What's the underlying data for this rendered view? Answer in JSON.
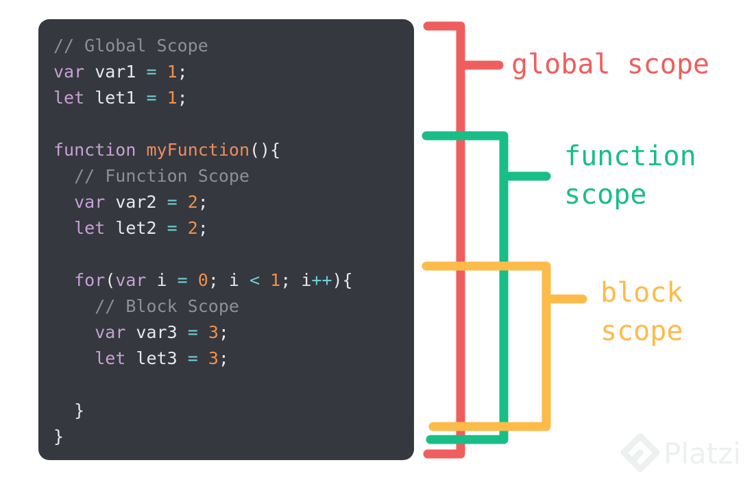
{
  "colors": {
    "panel_background": "#35383e",
    "comment": "#8d9097",
    "keyword": "#c7a0d6",
    "function_name": "#ef8c5f",
    "number": "#f0914c",
    "operator": "#6fd0d9",
    "identifier": "#e8e8ea",
    "global_scope": "#ef5e5e",
    "function_scope": "#18be86",
    "block_scope": "#fdbb4a"
  },
  "code": {
    "lines": [
      [
        {
          "t": "// Global Scope",
          "k": "comment"
        }
      ],
      [
        {
          "t": "var",
          "k": "keyword"
        },
        {
          "t": " var1 ",
          "k": "ident"
        },
        {
          "t": "=",
          "k": "op"
        },
        {
          "t": " ",
          "k": "ident"
        },
        {
          "t": "1",
          "k": "number"
        },
        {
          "t": ";",
          "k": "punct"
        }
      ],
      [
        {
          "t": "let",
          "k": "keyword"
        },
        {
          "t": " let1 ",
          "k": "ident"
        },
        {
          "t": "=",
          "k": "op"
        },
        {
          "t": " ",
          "k": "ident"
        },
        {
          "t": "1",
          "k": "number"
        },
        {
          "t": ";",
          "k": "punct"
        }
      ],
      [],
      [
        {
          "t": "function",
          "k": "keyword"
        },
        {
          "t": " ",
          "k": "ident"
        },
        {
          "t": "myFunction",
          "k": "func"
        },
        {
          "t": "(){",
          "k": "punct"
        }
      ],
      [
        {
          "t": "  // Function Scope",
          "k": "comment"
        }
      ],
      [
        {
          "t": "  ",
          "k": "ident"
        },
        {
          "t": "var",
          "k": "keyword"
        },
        {
          "t": " var2 ",
          "k": "ident"
        },
        {
          "t": "=",
          "k": "op"
        },
        {
          "t": " ",
          "k": "ident"
        },
        {
          "t": "2",
          "k": "number"
        },
        {
          "t": ";",
          "k": "punct"
        }
      ],
      [
        {
          "t": "  ",
          "k": "ident"
        },
        {
          "t": "let",
          "k": "keyword"
        },
        {
          "t": " let2 ",
          "k": "ident"
        },
        {
          "t": "=",
          "k": "op"
        },
        {
          "t": " ",
          "k": "ident"
        },
        {
          "t": "2",
          "k": "number"
        },
        {
          "t": ";",
          "k": "punct"
        }
      ],
      [],
      [
        {
          "t": "  ",
          "k": "ident"
        },
        {
          "t": "for",
          "k": "keyword"
        },
        {
          "t": "(",
          "k": "punct"
        },
        {
          "t": "var",
          "k": "keyword"
        },
        {
          "t": " i ",
          "k": "ident"
        },
        {
          "t": "=",
          "k": "op"
        },
        {
          "t": " ",
          "k": "ident"
        },
        {
          "t": "0",
          "k": "number"
        },
        {
          "t": "; i ",
          "k": "ident"
        },
        {
          "t": "<",
          "k": "op"
        },
        {
          "t": " ",
          "k": "ident"
        },
        {
          "t": "1",
          "k": "number"
        },
        {
          "t": "; i",
          "k": "ident"
        },
        {
          "t": "++",
          "k": "op"
        },
        {
          "t": "){",
          "k": "punct"
        }
      ],
      [
        {
          "t": "    // Block Scope",
          "k": "comment"
        }
      ],
      [
        {
          "t": "    ",
          "k": "ident"
        },
        {
          "t": "var",
          "k": "keyword"
        },
        {
          "t": " var3 ",
          "k": "ident"
        },
        {
          "t": "=",
          "k": "op"
        },
        {
          "t": " ",
          "k": "ident"
        },
        {
          "t": "3",
          "k": "number"
        },
        {
          "t": ";",
          "k": "punct"
        }
      ],
      [
        {
          "t": "    ",
          "k": "ident"
        },
        {
          "t": "let",
          "k": "keyword"
        },
        {
          "t": " let3 ",
          "k": "ident"
        },
        {
          "t": "=",
          "k": "op"
        },
        {
          "t": " ",
          "k": "ident"
        },
        {
          "t": "3",
          "k": "number"
        },
        {
          "t": ";",
          "k": "punct"
        }
      ],
      [],
      [
        {
          "t": "  }",
          "k": "punct"
        }
      ],
      [
        {
          "t": "}",
          "k": "punct"
        }
      ]
    ]
  },
  "labels": {
    "global": "global scope",
    "function": "function\nscope",
    "block": "block\nscope"
  },
  "watermark": {
    "logo_icon": "platzi-logo-icon",
    "text": "Platzi"
  }
}
